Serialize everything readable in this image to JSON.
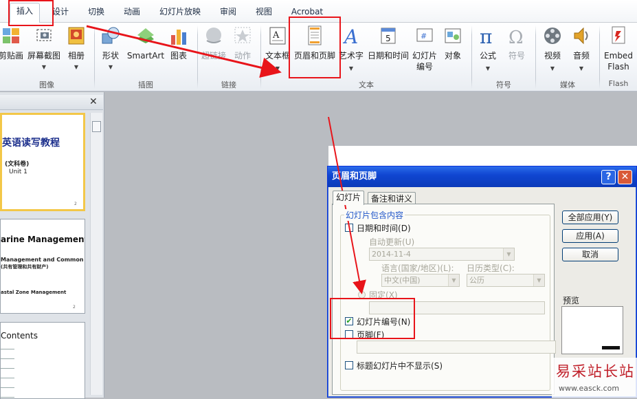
{
  "ribbon_tabs": [
    "插入",
    "设计",
    "切换",
    "动画",
    "幻灯片放映",
    "审阅",
    "视图",
    "Acrobat"
  ],
  "ribbon_buttons": {
    "clipboard": "剪贴画",
    "screenshot": "屏幕截图",
    "album": "相册",
    "shapes": "形状",
    "smartart": "SmartArt",
    "chart": "图表",
    "hyperlink": "超链接",
    "action": "动作",
    "textbox": "文本框",
    "header_footer": "页眉和页脚",
    "wordart": "艺术字",
    "datetime": "日期和时间",
    "slide_number": "幻灯片\n编号",
    "object": "对象",
    "equation": "公式",
    "symbol": "符号",
    "video": "视频",
    "audio": "音频",
    "embed_flash": "Embed\nFlash"
  },
  "ribbon_groups": {
    "images": "图像",
    "illustrations": "插图",
    "links": "链接",
    "text": "文本",
    "symbols": "符号",
    "media": "媒体",
    "flash": "Flash"
  },
  "thumbnails": {
    "t1_title": "英语读写教程",
    "t1_sub": "(文科卷)",
    "t1_unit": "Unit 1",
    "t2_title": "arine Management",
    "t2_line1": "Management and Common",
    "t2_line2": "(共有管理和共有财产)",
    "t2_line3": "astal Zone Management",
    "t3_title": "Contents",
    "page_num": "2"
  },
  "panel_close": "✕",
  "dialog": {
    "title": "页眉和页脚",
    "help_btn": "?",
    "close_btn": "✕",
    "tab_slide": "幻灯片",
    "tab_notes": "备注和讲义",
    "group_title": "幻灯片包含内容",
    "date_time": "日期和时间",
    "date_time_key": "(D)",
    "auto_update": "自动更新",
    "auto_update_key": "(U)",
    "date_value": "2014-11-4",
    "language_label": "语言(国家/地区)",
    "language_key": "(L):",
    "calendar_label": "日历类型",
    "calendar_key": "(C):",
    "language_value": "中文(中国)",
    "calendar_value": "公历",
    "fixed": "固定",
    "fixed_key": "(X)",
    "slide_number": "幻灯片编号",
    "slide_number_key": "(N)",
    "slide_number_checked": true,
    "footer": "页脚",
    "footer_key": "(F)",
    "no_title_slide": "标题幻灯片中不显示",
    "no_title_slide_key": "(S)",
    "apply_all": "全部应用(Y)",
    "apply": "应用(A)",
    "cancel": "取消",
    "preview": "预览"
  },
  "watermark": {
    "text": "易采站长站",
    "url": "www.easck.com"
  },
  "colors": {
    "annotation_red": "#e8141a",
    "dialog_title_blue": "#1046d2"
  }
}
